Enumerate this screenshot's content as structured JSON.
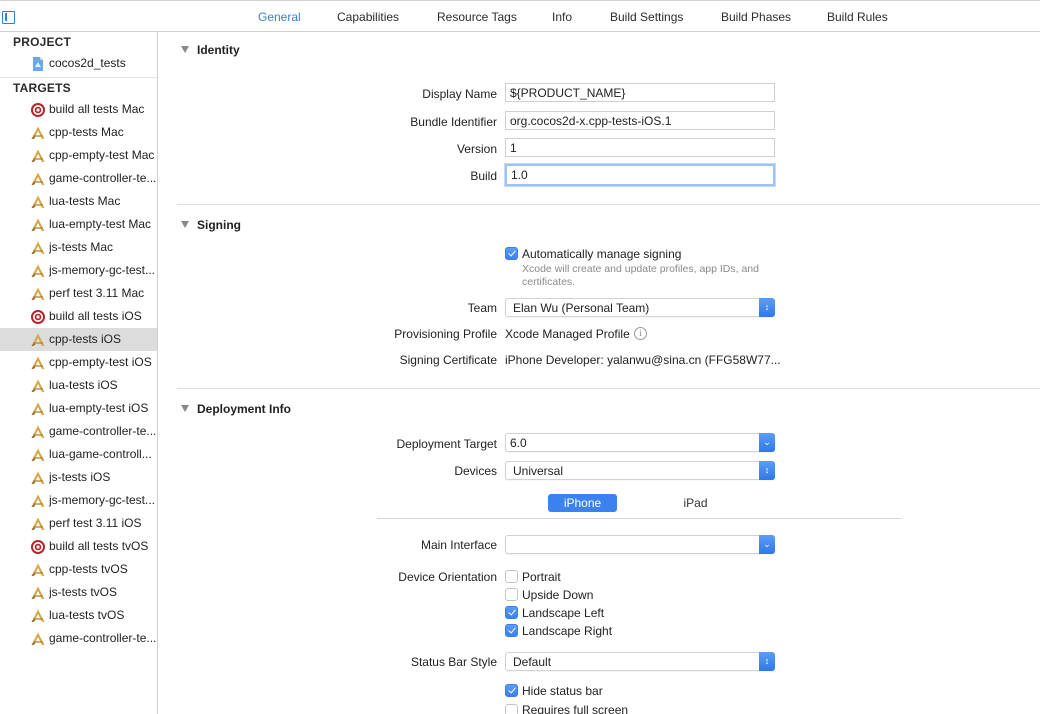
{
  "tabs": [
    {
      "label": "General",
      "active": true
    },
    {
      "label": "Capabilities",
      "active": false
    },
    {
      "label": "Resource Tags",
      "active": false
    },
    {
      "label": "Info",
      "active": false
    },
    {
      "label": "Build Settings",
      "active": false
    },
    {
      "label": "Build Phases",
      "active": false
    },
    {
      "label": "Build Rules",
      "active": false
    }
  ],
  "sidebar": {
    "project_header": "PROJECT",
    "project": {
      "label": "cocos2d_tests",
      "icon": "project-file-icon"
    },
    "targets_header": "TARGETS",
    "targets": [
      {
        "label": "build all tests Mac",
        "icon": "aggregate-target-icon"
      },
      {
        "label": "cpp-tests Mac",
        "icon": "app-target-icon"
      },
      {
        "label": "cpp-empty-test Mac",
        "icon": "app-target-icon"
      },
      {
        "label": "game-controller-te...",
        "icon": "app-target-icon"
      },
      {
        "label": "lua-tests Mac",
        "icon": "app-target-icon"
      },
      {
        "label": "lua-empty-test Mac",
        "icon": "app-target-icon"
      },
      {
        "label": "js-tests Mac",
        "icon": "app-target-icon"
      },
      {
        "label": "js-memory-gc-test...",
        "icon": "app-target-icon"
      },
      {
        "label": "perf test 3.11 Mac",
        "icon": "app-target-icon"
      },
      {
        "label": "build all tests iOS",
        "icon": "aggregate-target-icon"
      },
      {
        "label": "cpp-tests iOS",
        "icon": "app-target-icon",
        "selected": true
      },
      {
        "label": "cpp-empty-test iOS",
        "icon": "app-target-icon"
      },
      {
        "label": "lua-tests iOS",
        "icon": "app-target-icon"
      },
      {
        "label": "lua-empty-test iOS",
        "icon": "app-target-icon"
      },
      {
        "label": "game-controller-te...",
        "icon": "app-target-icon"
      },
      {
        "label": "lua-game-controll...",
        "icon": "app-target-icon"
      },
      {
        "label": "js-tests iOS",
        "icon": "app-target-icon"
      },
      {
        "label": "js-memory-gc-test...",
        "icon": "app-target-icon"
      },
      {
        "label": "perf test 3.11 iOS",
        "icon": "app-target-icon"
      },
      {
        "label": "build all tests tvOS",
        "icon": "aggregate-target-icon"
      },
      {
        "label": "cpp-tests tvOS",
        "icon": "app-target-icon"
      },
      {
        "label": "js-tests tvOS",
        "icon": "app-target-icon"
      },
      {
        "label": "lua-tests tvOS",
        "icon": "app-target-icon"
      },
      {
        "label": "game-controller-te...",
        "icon": "app-target-icon"
      }
    ]
  },
  "identity": {
    "title": "Identity",
    "display_name_label": "Display Name",
    "display_name": "${PRODUCT_NAME}",
    "bundle_id_label": "Bundle Identifier",
    "bundle_id": "org.cocos2d-x.cpp-tests-iOS.1",
    "version_label": "Version",
    "version": "1",
    "build_label": "Build",
    "build": "1.0"
  },
  "signing": {
    "title": "Signing",
    "auto_manage_label": "Automatically manage signing",
    "auto_manage_checked": true,
    "auto_manage_hint": "Xcode will create and update profiles, app IDs, and certificates.",
    "team_label": "Team",
    "team": "Elan Wu (Personal Team)",
    "provisioning_label": "Provisioning Profile",
    "provisioning": "Xcode Managed Profile",
    "certificate_label": "Signing Certificate",
    "certificate": "iPhone Developer: yalanwu@sina.cn (FFG58W77..."
  },
  "deployment": {
    "title": "Deployment Info",
    "target_label": "Deployment Target",
    "target": "6.0",
    "devices_label": "Devices",
    "devices": "Universal",
    "segments": [
      "iPhone",
      "iPad"
    ],
    "active_segment": "iPhone",
    "main_interface_label": "Main Interface",
    "main_interface": "",
    "orientation_label": "Device Orientation",
    "orientations": [
      {
        "label": "Portrait",
        "checked": false
      },
      {
        "label": "Upside Down",
        "checked": false
      },
      {
        "label": "Landscape Left",
        "checked": true
      },
      {
        "label": "Landscape Right",
        "checked": true
      }
    ],
    "status_bar_label": "Status Bar Style",
    "status_bar": "Default",
    "hide_status_bar_label": "Hide status bar",
    "hide_status_bar_checked": true,
    "full_screen_label": "Requires full screen",
    "full_screen_checked": false
  },
  "colors": {
    "accent": "#3b82ee",
    "active_tab": "#3d7fcf",
    "aggregate_icon": "#b3262a",
    "app_icon": "#d9a64a"
  }
}
